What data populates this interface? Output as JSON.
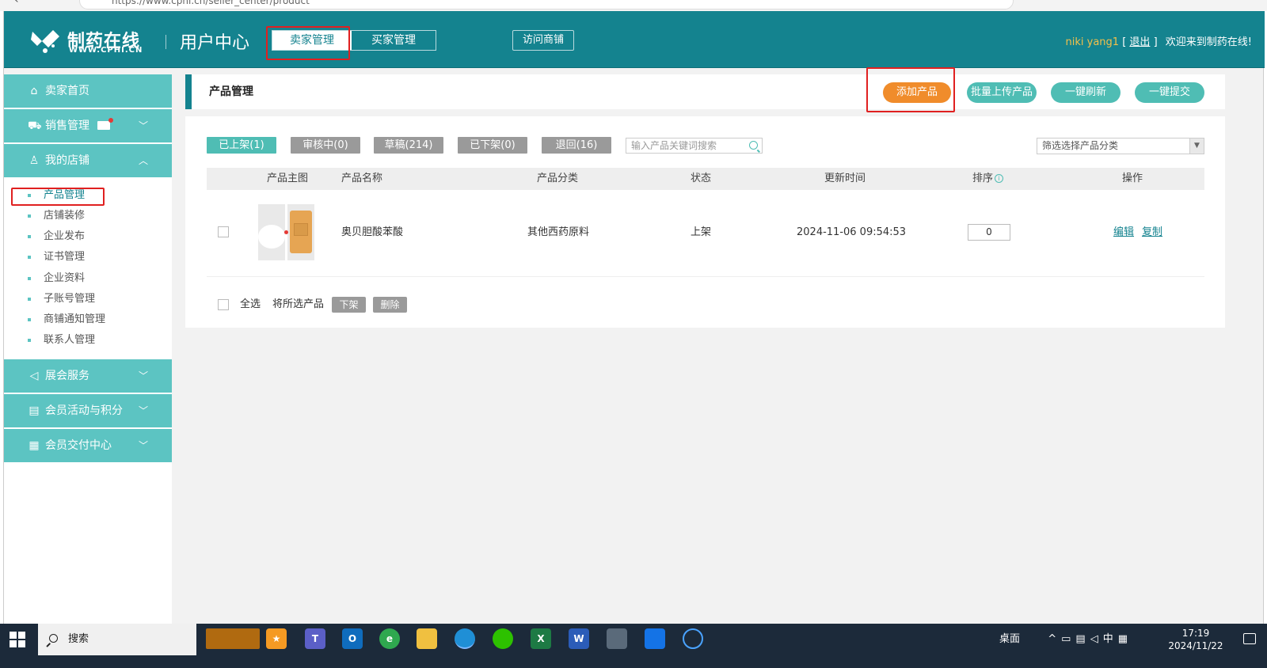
{
  "browser": {
    "url": "https://www.cphi.cn/seller_center/product"
  },
  "header": {
    "logo_name": "制药在线",
    "logo_sub": "WWW.CPHI.CN",
    "title": "用户中心",
    "tabs": [
      {
        "label": "卖家管理",
        "active": true
      },
      {
        "label": "买家管理",
        "active": false
      }
    ],
    "visit_shop": "访问商铺",
    "user_name": "niki yang1",
    "bracket_open": "[",
    "logout": "退出",
    "bracket_close": "]",
    "welcome": "欢迎来到制药在线!"
  },
  "sidebar": {
    "items": [
      {
        "label": "卖家首页",
        "icon": "home-icon"
      },
      {
        "label": "销售管理",
        "icon": "cart-icon",
        "has_mail": true
      },
      {
        "label": "我的店铺",
        "icon": "user-icon",
        "expanded": true
      },
      {
        "label": "展会服务",
        "icon": "speaker-icon"
      },
      {
        "label": "会员活动与积分",
        "icon": "gift-icon"
      },
      {
        "label": "会员交付中心",
        "icon": "document-icon"
      }
    ],
    "sub_items": [
      {
        "label": "产品管理",
        "active": true
      },
      {
        "label": "店铺装修"
      },
      {
        "label": "企业发布"
      },
      {
        "label": "证书管理"
      },
      {
        "label": "企业资料"
      },
      {
        "label": "子账号管理"
      },
      {
        "label": "商铺通知管理"
      },
      {
        "label": "联系人管理"
      }
    ]
  },
  "main": {
    "title": "产品管理",
    "actions": {
      "add": "添加产品",
      "batch_upload": "批量上传产品",
      "refresh_all": "一键刷新",
      "submit_all": "一键提交"
    },
    "filter_tabs": [
      {
        "label": "已上架(1)",
        "active": true
      },
      {
        "label": "审核中(0)"
      },
      {
        "label": "草稿(214)"
      },
      {
        "label": "已下架(0)"
      },
      {
        "label": "退回(16)"
      }
    ],
    "search_placeholder": "输入产品关键词搜索",
    "category_select": "筛选选择产品分类",
    "columns": [
      "产品主图",
      "产品名称",
      "产品分类",
      "状态",
      "更新时间",
      "排序",
      "操作"
    ],
    "rows": [
      {
        "name": "奥贝胆酸苯酸",
        "category": "其他西药原料",
        "status": "上架",
        "updated": "2024-11-06 09:54:53",
        "order": "0",
        "ops": [
          "编辑",
          "复制"
        ]
      }
    ],
    "bottom": {
      "select_all": "全选",
      "selected_label": "将所选产品",
      "offline": "下架",
      "delete": "删除"
    }
  },
  "taskbar": {
    "search": "搜索",
    "desktop": "桌面",
    "ime": "中",
    "time": "17:19",
    "date": "2024/11/22"
  },
  "colors": {
    "brand": "#14838f",
    "accent_teal": "#5cc4c2",
    "orange": "#f08c2b",
    "highlight_red": "#e02020"
  }
}
